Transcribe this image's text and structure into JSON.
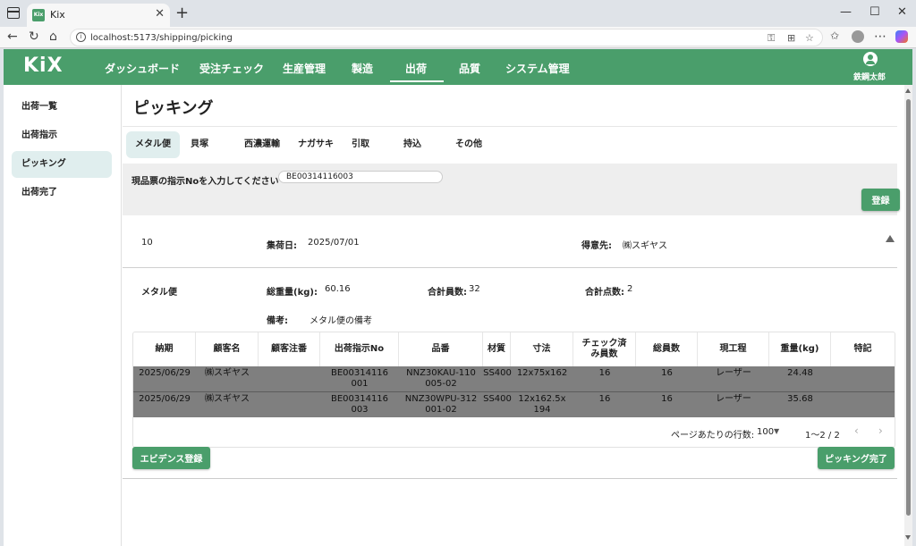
{
  "browser": {
    "tab_title": "Kix",
    "favicon_text": "Kix",
    "url": "localhost:5173/shipping/picking"
  },
  "header": {
    "logo": "KiX",
    "nav": [
      "ダッシュボード",
      "受注チェック",
      "生産管理",
      "製造",
      "出荷",
      "品質",
      "システム管理"
    ],
    "active_nav": "出荷",
    "user_name": "鉄鋼太郎"
  },
  "sidebar": {
    "items": [
      "出荷一覧",
      "出荷指示",
      "ピッキング",
      "出荷完了"
    ],
    "active": "ピッキング"
  },
  "page": {
    "title": "ピッキング",
    "carrier_tabs": [
      "メタル便",
      "貝塚",
      "西濃運輸",
      "ナガサキ",
      "引取",
      "持込",
      "その他"
    ],
    "active_carrier": "メタル便",
    "input_label": "現品票の指示Noを入力してください",
    "input_value": "BE00314116003",
    "register_button": "登録"
  },
  "shipment": {
    "number": "10",
    "collect_date_label": "集荷日:",
    "collect_date": "2025/07/01",
    "customer_label": "得意先:",
    "customer": "㈱スギヤス",
    "carrier": "メタル便",
    "total_weight_label": "総重量(kg):",
    "total_weight": "60.16",
    "total_members_label": "合計員数:",
    "total_members": "32",
    "total_items_label": "合計点数:",
    "total_items": "2",
    "remarks_label": "備考:",
    "remarks": "メタル便の備考"
  },
  "table": {
    "columns": [
      "納期",
      "顧客名",
      "顧客注番",
      "出荷指示No",
      "品番",
      "材質",
      "寸法",
      "チェック済み員数",
      "総員数",
      "現工程",
      "重量(kg)",
      "特記"
    ],
    "rows": [
      [
        "2025/06/29",
        "㈱スギヤス",
        "",
        "BE00314116001",
        "NNZ30KAU-110005-02",
        "SS400",
        "12x75x162",
        "16",
        "16",
        "レーザー",
        "24.48",
        ""
      ],
      [
        "2025/06/29",
        "㈱スギヤス",
        "",
        "BE00314116003",
        "NNZ30WPU-312001-02",
        "SS400",
        "12x162.5x194",
        "16",
        "16",
        "レーザー",
        "35.68",
        ""
      ]
    ],
    "rows_per_page_label": "ページあたりの行数:",
    "rows_per_page": "100",
    "range": "1〜2 / 2"
  },
  "actions": {
    "evidence_button": "エビデンス登録",
    "complete_button": "ピッキング完了"
  }
}
